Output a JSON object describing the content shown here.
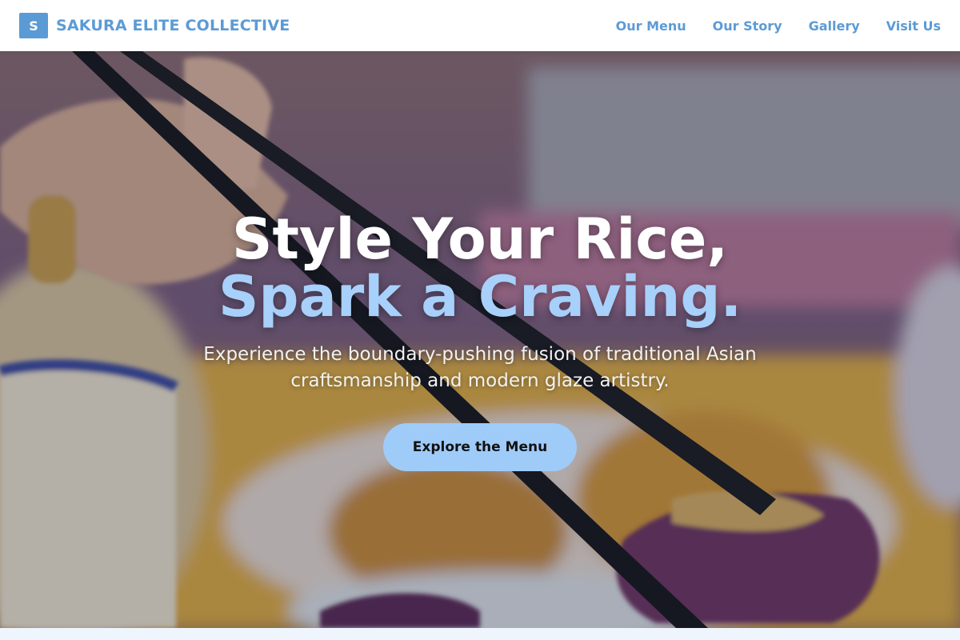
{
  "header": {
    "logo_letter": "S",
    "brand_name": "SAKURA ELITE COLLECTIVE",
    "nav": [
      "Our Menu",
      "Our Story",
      "Gallery",
      "Visit Us"
    ]
  },
  "hero": {
    "headline_line1": "Style Your Rice,",
    "headline_line2": "Spark a Craving.",
    "subtitle": "Experience the boundary-pushing fusion of traditional Asian craftsmanship and modern glaze artistry.",
    "cta_label": "Explore the Menu",
    "background_image": "chopsticks-holding-glazed-eggplant-photo"
  },
  "colors": {
    "brand": "#5b9bd5",
    "accent": "#a7d0fb",
    "cta_bg": "#9fcbf8"
  }
}
